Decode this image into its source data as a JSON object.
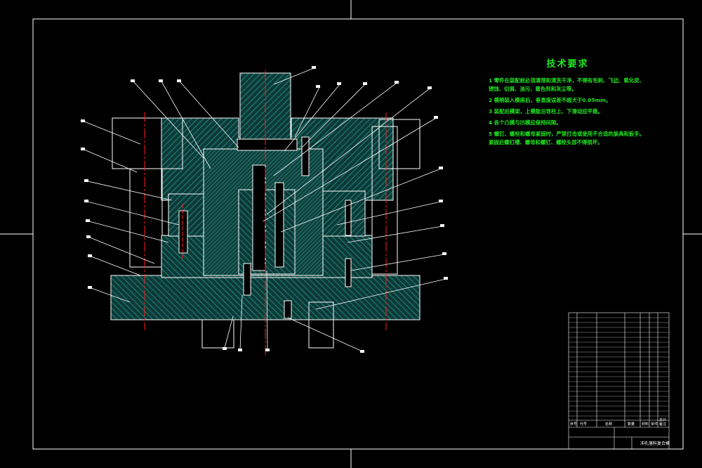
{
  "technical_requirements": {
    "title": "技术要求",
    "items": [
      "1 零件在装配前必须清理和清洗干净，不得有毛刺、飞边、氧化皮、锈蚀、切屑、油污、着色剂和灰尘等。",
      "2 模柄装入模座后，垂直度误差不超大于0.05mm。",
      "3 装配后模架，上模能沿导柱上、下滑动应平稳。",
      "4 各个凸模与凹模应保持间隙。",
      "5 螺钉、螺栓和螺母紧固时，严禁打击或使用不合适的旋具和扳手。紧固后螺钉槽、螺母和螺钉、螺栓头部不得损坏。"
    ]
  },
  "title_block": {
    "drawing_name": "冲孔落料复合模",
    "row_labels": [
      "序号",
      "代号",
      "名称",
      "数量",
      "材料",
      "单件",
      "总计",
      "备注"
    ]
  },
  "colors": {
    "background": "#000000",
    "outline": "#ffffff",
    "hatch": "#2aa39a",
    "centerline": "#ff2020",
    "text_green": "#22e522",
    "leader": "#ffffff"
  }
}
